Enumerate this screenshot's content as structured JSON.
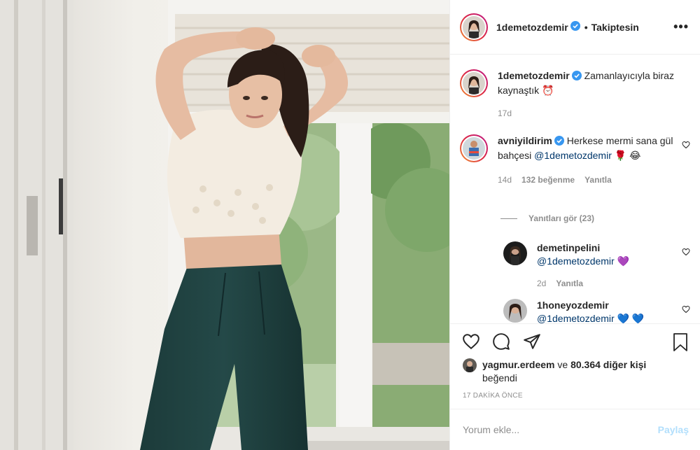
{
  "post": {
    "author": "1demetozdemir",
    "separator": "•",
    "follow_status": "Takiptesin",
    "more_label": "•••"
  },
  "caption": {
    "username": "1demetozdemir",
    "text": "Zamanlayıcıyla biraz kaynaştık ⏰",
    "time": "17d"
  },
  "comments": [
    {
      "username": "avniyildirim",
      "text_before": "Herkese mermi sana gül bahçesi ",
      "mention": "@1demetozdemir",
      "text_after": " 🌹 😂",
      "time": "14d",
      "likes": "132 beğenme",
      "reply": "Yanıtla"
    }
  ],
  "view_replies": "Yanıtları gör (23)",
  "replies": [
    {
      "username": "demetinpelini",
      "mention": "@1demetozdemir",
      "text_after": " 💜",
      "time": "2d",
      "reply": "Yanıtla"
    },
    {
      "username": "1honeyozdemir",
      "mention": "@1demetozdemir",
      "text_after": " 💙 💙"
    }
  ],
  "likes": {
    "username": "yagmur.erdeem",
    "connector": " ve ",
    "count": "80.364 diğer kişi",
    "suffix": " beğendi"
  },
  "time_ago": "17 DAKİKA ÖNCE",
  "add_comment": {
    "placeholder": "Yorum ekle...",
    "post_label": "Paylaş"
  },
  "icons": [
    "heart-icon",
    "comment-icon",
    "share-icon",
    "bookmark-icon",
    "verified-icon",
    "alarm-clock-icon"
  ],
  "colors": {
    "verified": "#3897f0",
    "mention": "#00376b",
    "post_disabled": "#b2dffc",
    "muted": "#8e8e8e"
  }
}
